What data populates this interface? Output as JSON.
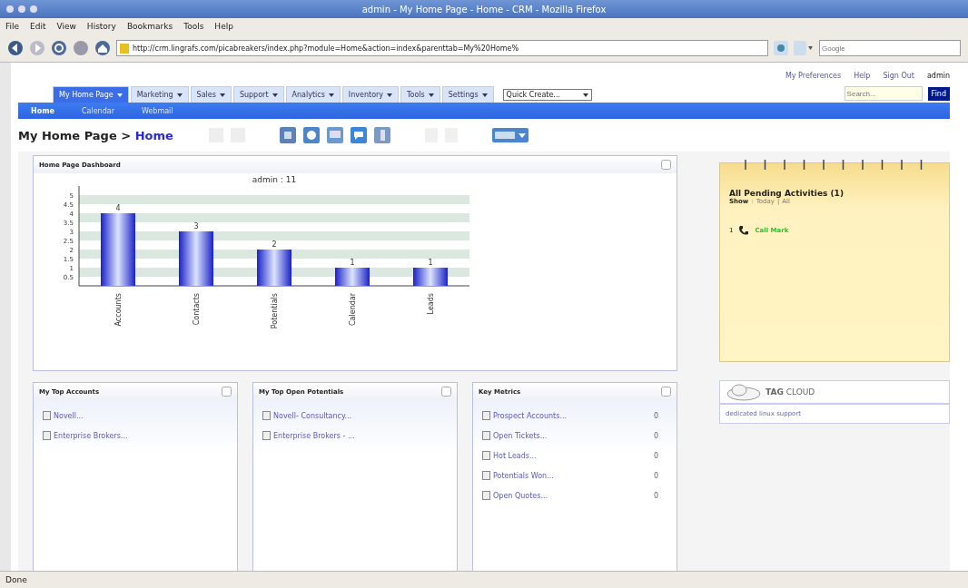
{
  "window": {
    "title": "admin - My Home Page - Home - CRM - Mozilla Firefox"
  },
  "menu": [
    "File",
    "Edit",
    "View",
    "History",
    "Bookmarks",
    "Tools",
    "Help"
  ],
  "toolbar": {
    "url": "http://crm.lingrafs.com/picabreakers/index.php?module=Home&action=index&parenttab=My%20Home%",
    "search_placeholder": "Google"
  },
  "top_links": [
    "My Preferences",
    "Help",
    "Sign Out"
  ],
  "user": "admin",
  "tabs": [
    {
      "label": "My Home Page",
      "selected": true
    },
    {
      "label": "Marketing",
      "selected": false
    },
    {
      "label": "Sales",
      "selected": false
    },
    {
      "label": "Support",
      "selected": false
    },
    {
      "label": "Analytics",
      "selected": false
    },
    {
      "label": "Inventory",
      "selected": false
    },
    {
      "label": "Tools",
      "selected": false
    },
    {
      "label": "Settings",
      "selected": false
    }
  ],
  "quick_create": "Quick Create...",
  "search": {
    "placeholder": "Search...",
    "button": "Find"
  },
  "subtabs": [
    {
      "label": "Home",
      "selected": true
    },
    {
      "label": "Calendar",
      "selected": false
    },
    {
      "label": "Webmail",
      "selected": false
    }
  ],
  "breadcrumb": {
    "parent": "My Home Page",
    "separator": ">",
    "current": "Home"
  },
  "dashboard": {
    "title": "Home Page Dashboard",
    "chart_data": {
      "type": "bar",
      "title": "admin : 11",
      "categories": [
        "Accounts",
        "Contacts",
        "Potentials",
        "Calendar",
        "Leads"
      ],
      "values": [
        4,
        3,
        2,
        1,
        1
      ],
      "ylim": [
        0,
        5.5
      ],
      "yticks": [
        0.5,
        1,
        1.5,
        2,
        2.5,
        3,
        3.5,
        4,
        4.5,
        5
      ],
      "data_labels": true
    }
  },
  "panels": [
    {
      "title": "My Top Accounts",
      "rows": [
        {
          "label": "Novell..."
        },
        {
          "label": "Enterprise Brokers..."
        }
      ]
    },
    {
      "title": "My Top Open Potentials",
      "rows": [
        {
          "label": "Novell- Consultancy..."
        },
        {
          "label": "Enterprise Brokers - ..."
        }
      ]
    },
    {
      "title": "Key Metrics",
      "rows": [
        {
          "label": "Prospect Accounts...",
          "count": "0"
        },
        {
          "label": "Open Tickets...",
          "count": "0"
        },
        {
          "label": "Hot Leads...",
          "count": "0"
        },
        {
          "label": "Potentials Won...",
          "count": "0"
        },
        {
          "label": "Open Quotes...",
          "count": "0"
        }
      ]
    }
  ],
  "activities": {
    "title": "All Pending Activities (1)",
    "show": "Show",
    "colon": ":",
    "divider": "|",
    "filters": [
      "Today",
      "All"
    ],
    "items": [
      {
        "number": "1",
        "label": "Call Mark"
      }
    ]
  },
  "tag_cloud": {
    "title_bold": "TAG",
    "title": "CLOUD",
    "tags": [
      "dedicated linux support"
    ]
  },
  "status_bar": "Done"
}
